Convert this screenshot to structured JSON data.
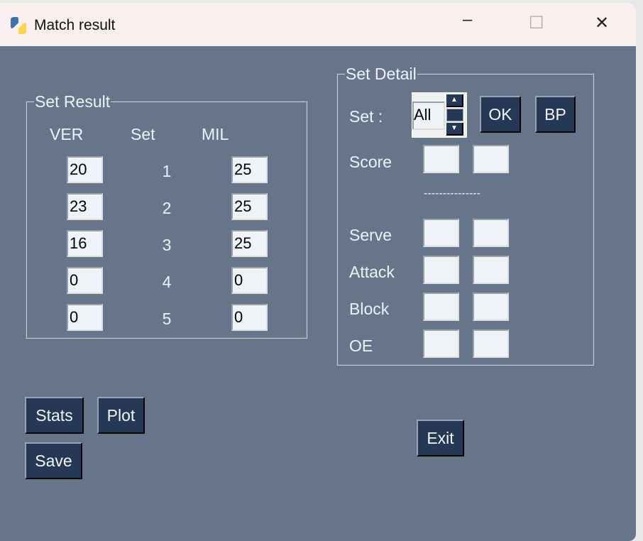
{
  "window": {
    "title": "Match result",
    "minimize": "–",
    "maximize": "☐",
    "close": "✕"
  },
  "set_result": {
    "legend": "Set Result",
    "headers": {
      "left": "VER",
      "mid": "Set",
      "right": "MIL"
    },
    "rows": [
      {
        "ver": "20",
        "set": "1",
        "mil": "25"
      },
      {
        "ver": "23",
        "set": "2",
        "mil": "25"
      },
      {
        "ver": "16",
        "set": "3",
        "mil": "25"
      },
      {
        "ver": "0",
        "set": "4",
        "mil": "0"
      },
      {
        "ver": "0",
        "set": "5",
        "mil": "0"
      }
    ]
  },
  "set_detail": {
    "legend": "Set Detail",
    "set_label": "Set :",
    "set_value": "All",
    "ok": "OK",
    "bp": "BP",
    "score": "Score",
    "separator": "---------------",
    "serve": "Serve",
    "attack": "Attack",
    "block": "Block",
    "oe": "OE"
  },
  "buttons": {
    "stats": "Stats",
    "plot": "Plot",
    "save": "Save",
    "exit": "Exit"
  }
}
